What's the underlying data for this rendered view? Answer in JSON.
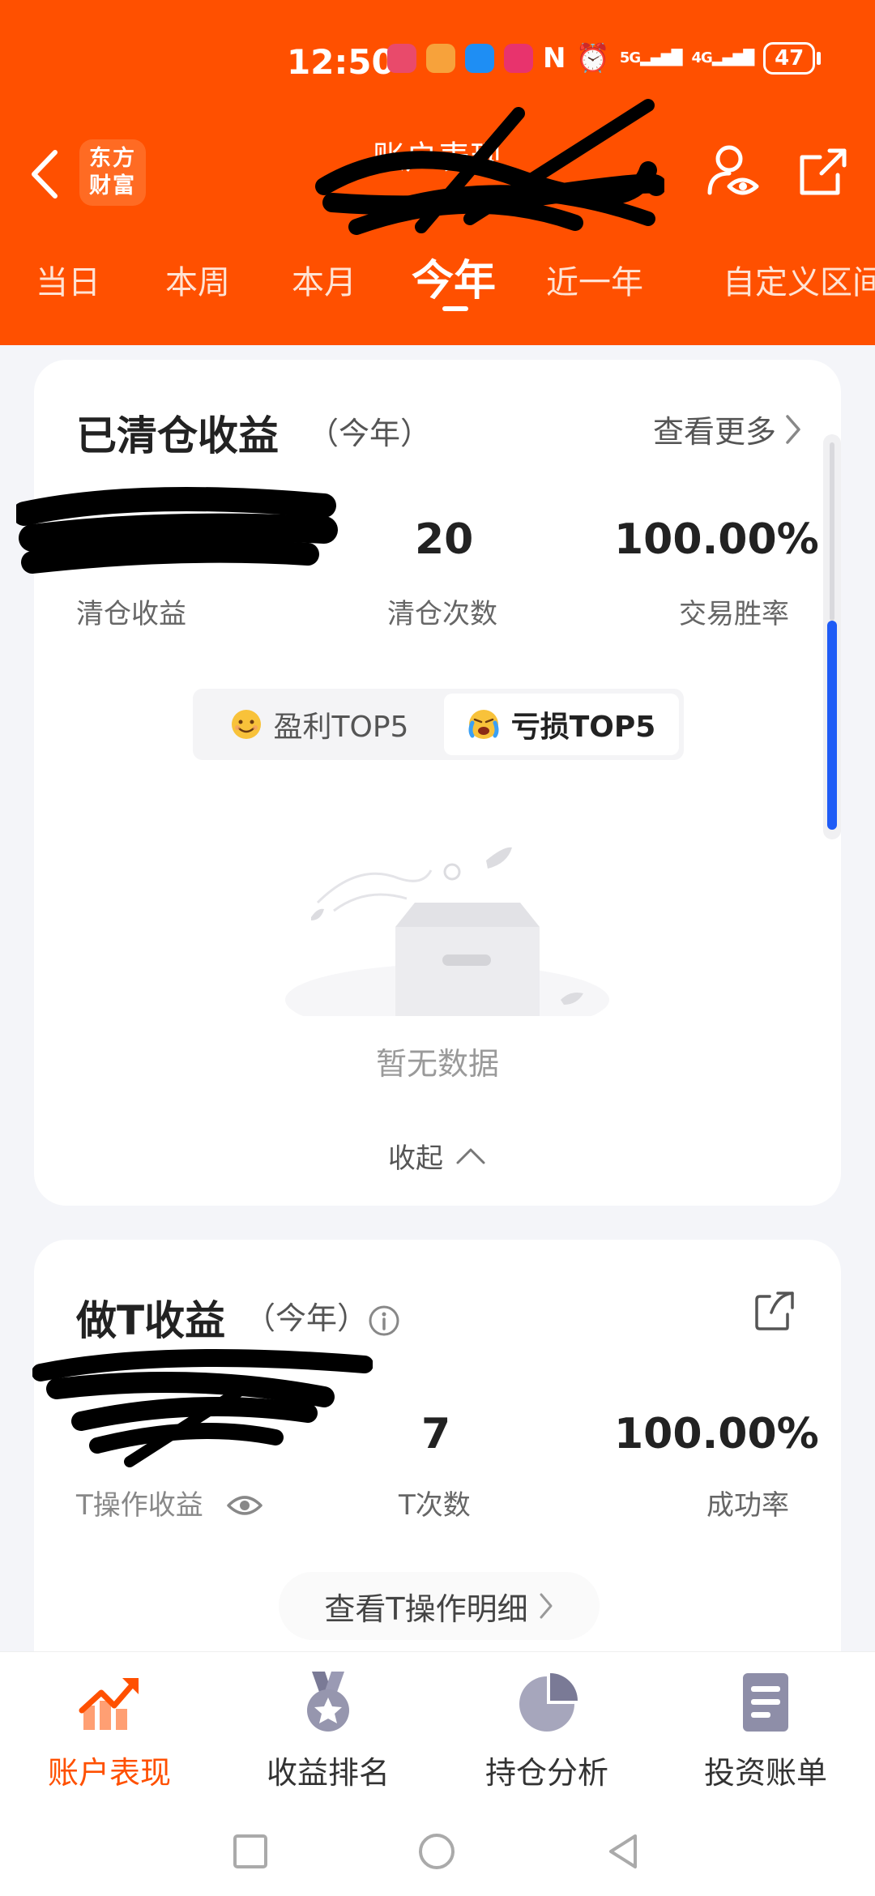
{
  "status_bar": {
    "time": "12:50",
    "network_1": "5G",
    "network_2": "4G",
    "battery": "47",
    "nfc": "N"
  },
  "header": {
    "logo_line1": "东方",
    "logo_line2": "财富",
    "title": "账户表现"
  },
  "tabs": [
    "当日",
    "本周",
    "本月",
    "今年",
    "近一年",
    "自定义区间"
  ],
  "cleared_card": {
    "title": "已清仓收益",
    "period": "（今年）",
    "see_more": "查看更多",
    "profit_label": "清仓收益",
    "count_value": "20",
    "count_label": "清仓次数",
    "win_rate_value": "100.00%",
    "win_rate_label": "交易胜率",
    "seg_profit": "盈利TOP5",
    "seg_loss": "亏损TOP5",
    "empty_text": "暂无数据",
    "collapse": "收起"
  },
  "t_card": {
    "title": "做T收益",
    "period": "（今年）",
    "profit_label": "T操作收益",
    "count_value": "7",
    "count_label": "T次数",
    "success_value": "100.00%",
    "success_label": "成功率",
    "detail_button": "查看T操作明细"
  },
  "bottom_nav": [
    "账户表现",
    "收益排名",
    "持仓分析",
    "投资账单"
  ],
  "colors": {
    "brand": "#ff5000",
    "scroll_thumb": "#1f5cf6"
  },
  "icons": {
    "back": "back-arrow-icon",
    "user_eye": "user-eye-icon",
    "share": "share-icon",
    "info": "info-icon",
    "eye": "eye-icon",
    "empty_box": "empty-box-icon",
    "nav_chart": "trend-chart-icon",
    "nav_medal": "medal-icon",
    "nav_pie": "pie-chart-icon",
    "nav_bill": "bill-icon"
  }
}
